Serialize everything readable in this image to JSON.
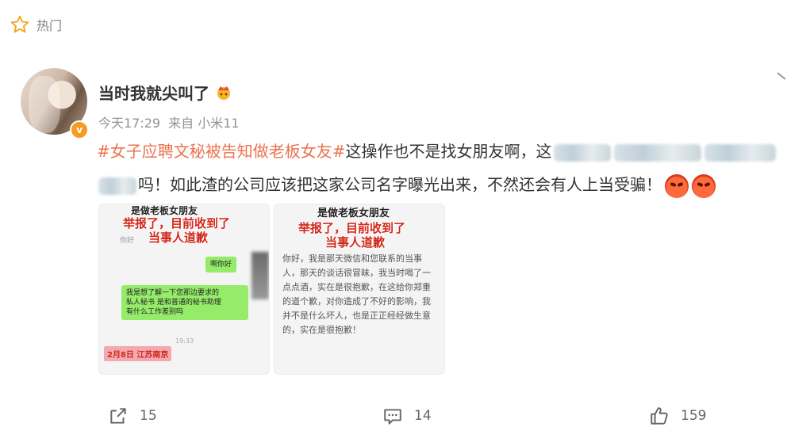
{
  "header": {
    "hot_label": "热门"
  },
  "post": {
    "username": "当时我就尖叫了",
    "time": "今天17:29",
    "source": "来自 小米11",
    "vip_badge": "v",
    "topic": "#女子应聘文秘被告知做老板女友#",
    "text_1": "这操作也不是找女朋友啊，这",
    "text_2": "吗！如此渣的公司应该把这家公司名字曝光出来，不然还会有人上当受骗！"
  },
  "images": [
    {
      "overlay_top": "是做老板女朋友",
      "overlay_line1": "举报了，目前收到了",
      "overlay_line2": "当事人道歉",
      "left_bubble": "你好",
      "right_bubble": "啊你好",
      "green_bubble": "我是想了解一下您那边要求的\n私人秘书 是和普通的秘书助理\n有什么工作差别吗",
      "timestamp": "19:33",
      "date_tag": "2月8日 江苏南京"
    },
    {
      "overlay_top": "是做老板女朋友",
      "overlay_line1": "举报了，目前收到了",
      "overlay_line2": "当事人道歉",
      "apology_text": "你好，我是那天微信和您联系的当事人，那天的谈话很冒昧，我当时喝了一点点酒，实在是很抱歉，在这给你郑重的道个歉，对你造成了不好的影响，我并不是什么坏人，也是正正经经做生意的，实在是很抱歉！"
    }
  ],
  "actions": {
    "reposts": "15",
    "comments": "14",
    "likes": "159"
  },
  "colors": {
    "topic": "#eb7350",
    "vip": "#f59a23",
    "hot_star": "#f5a623"
  }
}
